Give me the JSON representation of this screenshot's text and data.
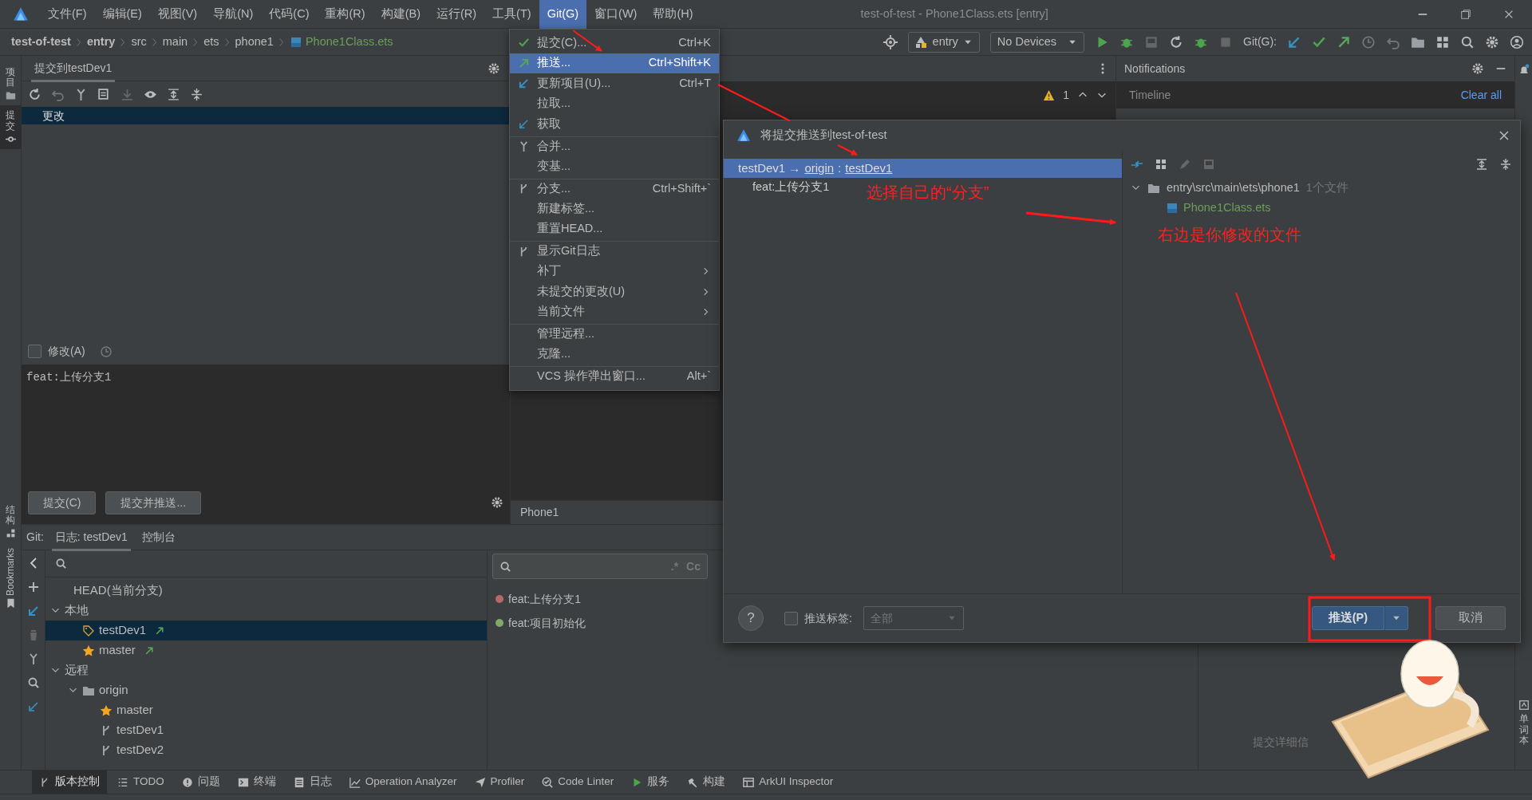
{
  "left_strip": [
    {
      "label": "项目",
      "kind": "folder",
      "selected": false
    },
    {
      "label": "提交",
      "kind": "commit",
      "selected": true
    },
    {
      "label": "结构",
      "kind": "structure",
      "selected": false
    },
    {
      "label": "Bookmarks",
      "kind": "bookmark",
      "selected": false
    }
  ],
  "title_bar": {
    "menus": [
      {
        "label": "文件(F)",
        "selected": false
      },
      {
        "label": "编辑(E)",
        "selected": false
      },
      {
        "label": "视图(V)",
        "selected": false
      },
      {
        "label": "导航(N)",
        "selected": false
      },
      {
        "label": "代码(C)",
        "selected": false
      },
      {
        "label": "重构(R)",
        "selected": false
      },
      {
        "label": "构建(B)",
        "selected": false
      },
      {
        "label": "运行(R)",
        "selected": false
      },
      {
        "label": "工具(T)",
        "selected": false
      },
      {
        "label": "Git(G)",
        "selected": true
      },
      {
        "label": "窗口(W)",
        "selected": false
      },
      {
        "label": "帮助(H)",
        "selected": false
      }
    ],
    "title": "test-of-test - Phone1Class.ets [entry]"
  },
  "nav_bar": {
    "breadcrumbs": [
      {
        "label": "test-of-test",
        "kind": "project"
      },
      {
        "label": "entry",
        "kind": "module"
      },
      {
        "label": "src",
        "kind": "folder"
      },
      {
        "label": "main",
        "kind": "folder"
      },
      {
        "label": "ets",
        "kind": "folder"
      },
      {
        "label": "phone1",
        "kind": "folder"
      },
      {
        "label": "Phone1Class.ets",
        "kind": "file"
      }
    ],
    "run_config": "entry",
    "device": "No Devices",
    "git_label": "Git(G):"
  },
  "commit_panel": {
    "tab": "提交到testDev1",
    "group": "更改",
    "amend": {
      "label": "修改(A)",
      "checked": false
    },
    "message": "feat:上传分支1",
    "buttons": [
      "提交(C)",
      "提交并推送..."
    ]
  },
  "editor": {
    "warning_count": "1",
    "tab": "Phone1"
  },
  "notifications": {
    "title": "Notifications",
    "timeline": "Timeline",
    "clear_all": "Clear all"
  },
  "git_panel": {
    "label": "Git:",
    "tabs": [
      {
        "label": "日志: testDev1",
        "selected": true
      },
      {
        "label": "控制台",
        "selected": false
      }
    ],
    "branches": [
      {
        "label": "HEAD(当前分支)",
        "kind": "head",
        "selected": false
      },
      {
        "label": "本地",
        "kind": "section",
        "expanded": true,
        "selected": false,
        "children": [
          {
            "label": "testDev1",
            "kind": "tag",
            "selected": true,
            "outgoing": true
          },
          {
            "label": "master",
            "kind": "star",
            "selected": false,
            "outgoing": true
          }
        ]
      },
      {
        "label": "远程",
        "kind": "section",
        "expanded": true,
        "selected": false,
        "children": [
          {
            "label": "origin",
            "kind": "folder",
            "expanded": true,
            "selected": false,
            "children": [
              {
                "label": "master",
                "kind": "star",
                "selected": false,
                "outgoing": false
              },
              {
                "label": "testDev1",
                "kind": "branch",
                "selected": false,
                "outgoing": false
              },
              {
                "label": "testDev2",
                "kind": "branch",
                "selected": false,
                "outgoing": false
              }
            ]
          }
        ]
      }
    ],
    "search_options": [
      ".*",
      "Cc"
    ],
    "commits": [
      {
        "message": "feat:上传分支1",
        "color": "#b56a6a"
      },
      {
        "message": "feat:项目初始化",
        "color": "#82a86a"
      }
    ],
    "details_hint": "提交详细信"
  },
  "tool_tabs": [
    {
      "label": "版本控制",
      "kind": "branch",
      "selected": true
    },
    {
      "label": "TODO",
      "kind": "list",
      "selected": false
    },
    {
      "label": "问题",
      "kind": "problem",
      "selected": false
    },
    {
      "label": "终端",
      "kind": "terminal",
      "selected": false
    },
    {
      "label": "日志",
      "kind": "log",
      "selected": false
    },
    {
      "label": "Operation Analyzer",
      "kind": "chart",
      "selected": false
    },
    {
      "label": "Profiler",
      "kind": "plane",
      "selected": false
    },
    {
      "label": "Code Linter",
      "kind": "linter",
      "selected": false
    },
    {
      "label": "服务",
      "kind": "play",
      "selected": false
    },
    {
      "label": "构建",
      "kind": "hammer",
      "selected": false
    },
    {
      "label": "ArkUI Inspector",
      "kind": "table",
      "selected": false
    }
  ],
  "right_strip": [
    {
      "label": "单词本"
    }
  ],
  "git_menu": {
    "items": [
      {
        "label": "提交(C)...",
        "shortcut": "Ctrl+K",
        "kind": "check",
        "selected": false,
        "submenu": false,
        "separator_before": false
      },
      {
        "label": "推送...",
        "shortcut": "Ctrl+Shift+K",
        "kind": "push",
        "selected": true,
        "submenu": false,
        "separator_before": false
      },
      {
        "label": "更新项目(U)...",
        "shortcut": "Ctrl+T",
        "kind": "update",
        "selected": false,
        "submenu": false,
        "separator_before": false
      },
      {
        "label": "拉取...",
        "kind": "none",
        "selected": false,
        "submenu": false,
        "separator_before": false
      },
      {
        "label": "获取",
        "kind": "fetch",
        "selected": false,
        "submenu": false,
        "separator_before": false
      },
      {
        "label": "合并...",
        "kind": "merge",
        "selected": false,
        "submenu": false,
        "separator_before": true
      },
      {
        "label": "变基...",
        "kind": "none",
        "selected": false,
        "submenu": false,
        "separator_before": false
      },
      {
        "label": "分支...",
        "shortcut": "Ctrl+Shift+`",
        "kind": "branch",
        "selected": false,
        "submenu": false,
        "separator_before": true
      },
      {
        "label": "新建标签...",
        "kind": "none",
        "selected": false,
        "submenu": false,
        "separator_before": false
      },
      {
        "label": "重置HEAD...",
        "kind": "none",
        "selected": false,
        "submenu": false,
        "separator_before": false
      },
      {
        "label": "显示Git日志",
        "kind": "branch",
        "selected": false,
        "submenu": false,
        "separator_before": true
      },
      {
        "label": "补丁",
        "kind": "none",
        "selected": false,
        "submenu": true,
        "separator_before": false
      },
      {
        "label": "未提交的更改(U)",
        "kind": "none",
        "selected": false,
        "submenu": true,
        "separator_before": false
      },
      {
        "label": "当前文件",
        "kind": "none",
        "selected": false,
        "submenu": true,
        "separator_before": false
      },
      {
        "label": "管理远程...",
        "kind": "none",
        "selected": false,
        "submenu": false,
        "separator_before": true
      },
      {
        "label": "克隆...",
        "kind": "none",
        "selected": false,
        "submenu": false,
        "separator_before": false
      },
      {
        "label": "VCS 操作弹出窗口...",
        "shortcut": "Alt+`",
        "kind": "none",
        "selected": false,
        "submenu": false,
        "separator_before": true
      }
    ]
  },
  "push_dialog": {
    "title": "将提交推送到test-of-test",
    "push_row": {
      "local": "testDev1",
      "arrow": "→",
      "remote": "origin",
      "colon": ":",
      "remote_branch": "testDev1",
      "selected": true
    },
    "commits": [
      "feat:上传分支1"
    ],
    "tree": {
      "folder": "entry\\src\\main\\ets\\phone1",
      "count": "1个文件",
      "expanded": true,
      "file": "Phone1Class.ets"
    },
    "help": "?",
    "push_tags": {
      "label": "推送标签:",
      "checked": false
    },
    "tags_select": {
      "value": "全部",
      "disabled": true
    },
    "buttons": [
      {
        "label": "推送(P)",
        "kind": "primary"
      },
      {
        "label": "取消",
        "kind": "secondary"
      }
    ]
  },
  "annotations": [
    {
      "text": "选择自己的“分支”"
    },
    {
      "text": "右边是你修改的文件"
    }
  ]
}
